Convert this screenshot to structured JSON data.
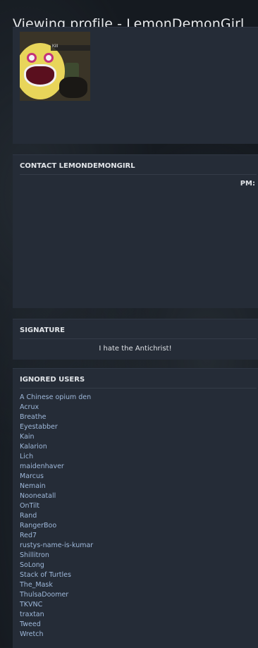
{
  "page": {
    "title": "Viewing profile - LemonDemonGirl"
  },
  "avatar": {
    "overlay_text": "Kill"
  },
  "contact": {
    "heading": "CONTACT LEMONDEMONGIRL",
    "pm_label": "PM:"
  },
  "signature": {
    "heading": "SIGNATURE",
    "text": "I hate the Antichrist!"
  },
  "ignored": {
    "heading": "IGNORED USERS",
    "users": [
      "A Chinese opium den",
      "Acrux",
      "Breathe",
      "Eyestabber",
      "Kain",
      "Kalarion",
      "Lich",
      "maidenhaver",
      "Marcus",
      "Nemain",
      "Nooneatall",
      "OnTilt",
      "Rand",
      "RangerBoo",
      "Red7",
      "rustys-name-is-kumar",
      "Shillitron",
      "SoLong",
      "Stack of Turtles",
      "The_Mask",
      "ThulsaDoomer",
      "TKVNC",
      "traxtan",
      "Tweed",
      "Wretch"
    ]
  },
  "colors": {
    "panel_bg": "#252c37",
    "link": "#9fb9db",
    "heading": "#e2e5e9"
  }
}
